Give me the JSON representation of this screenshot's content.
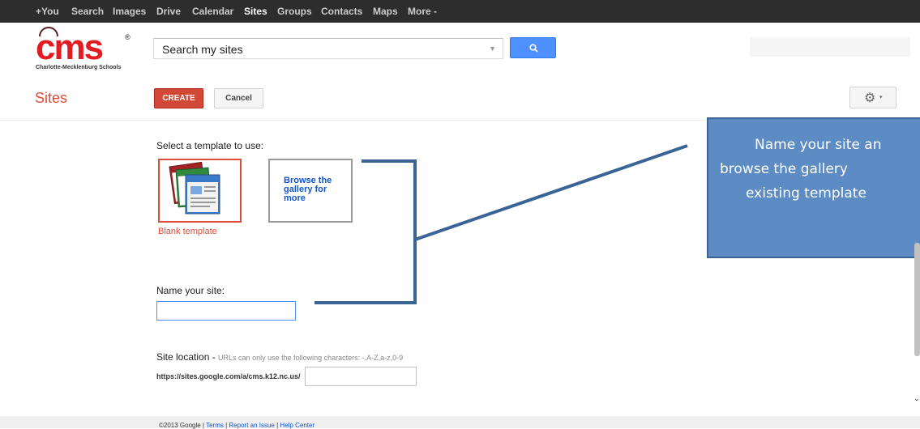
{
  "gbar": {
    "items": [
      "+You",
      "Search",
      "Images",
      "Drive",
      "Calendar",
      "Sites",
      "Groups",
      "Contacts",
      "Maps",
      "More -"
    ],
    "active": "Sites"
  },
  "logo": {
    "text": "cms",
    "registered": "®",
    "subtitle": "Charlotte-Mecklenburg Schools"
  },
  "search": {
    "value": "Search my sites",
    "button_icon": "magnifier-icon"
  },
  "toolbar": {
    "title": "Sites",
    "create_label": "CREATE",
    "cancel_label": "Cancel",
    "settings_icon": "gear-icon",
    "settings_caret": "▾"
  },
  "templates": {
    "prompt": "Select a template to use:",
    "blank_label": "Blank template",
    "browse_label": "Browse the gallery for more"
  },
  "name_site": {
    "label": "Name your site:",
    "value": ""
  },
  "location": {
    "title": "Site location - ",
    "hint": "URLs can only use the following characters: -,A-Z,a-z,0-9",
    "prefix": "https://sites.google.com/a/cms.k12.nc.us/",
    "value": ""
  },
  "footer": {
    "copyright": "©2013 Google | ",
    "terms": "Terms",
    "sep1": " | ",
    "report": "Report an Issue",
    "sep2": " | ",
    "help": "Help Center"
  },
  "callout": {
    "lines": [
      "Name your site an",
      "browse the gallery",
      "existing template"
    ]
  },
  "colors": {
    "accent_red": "#dd4b39",
    "create_red": "#d14836",
    "search_blue": "#4d90fe",
    "callout_blue": "#5c8cc3",
    "connector": "#3b6496"
  }
}
